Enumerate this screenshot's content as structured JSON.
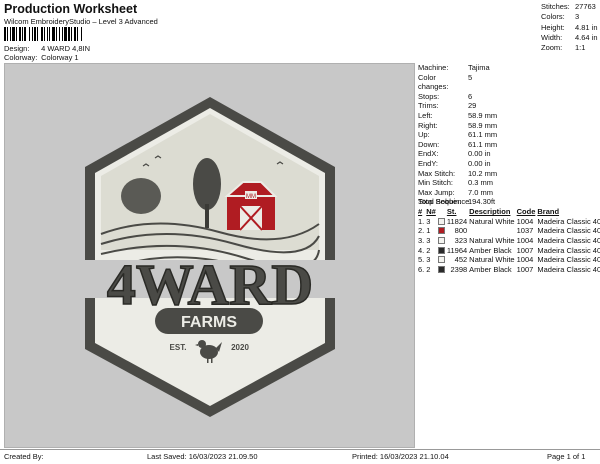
{
  "header": {
    "title": "Production Worksheet",
    "subtitle": "Wilcom EmbroideryStudio – Level 3 Advanced",
    "design_label": "Design:",
    "design_value": "4 WARD 4,8IN",
    "colorway_label": "Colorway:",
    "colorway_value": "Colorway 1"
  },
  "summary": [
    {
      "label": "Stitches:",
      "value": "27763"
    },
    {
      "label": "Colors:",
      "value": "3"
    },
    {
      "label": "Height:",
      "value": "4.81 in"
    },
    {
      "label": "Width:",
      "value": "4.64 in"
    },
    {
      "label": "Zoom:",
      "value": "1:1"
    }
  ],
  "specs": [
    {
      "label": "Machine:",
      "value": "Tajima"
    },
    {
      "label": "Color changes:",
      "value": "5"
    },
    {
      "label": "Stops:",
      "value": "6"
    },
    {
      "label": "Trims:",
      "value": "29"
    },
    {
      "label": "Left:",
      "value": "58.9 mm"
    },
    {
      "label": "Right:",
      "value": "58.9 mm"
    },
    {
      "label": "Up:",
      "value": "61.1 mm"
    },
    {
      "label": "Down:",
      "value": "61.1 mm"
    },
    {
      "label": "EndX:",
      "value": "0.00 in"
    },
    {
      "label": "EndY:",
      "value": "0.00 in"
    },
    {
      "label": "Max Stitch:",
      "value": "10.2 mm"
    },
    {
      "label": "Min Stitch:",
      "value": "0.3 mm"
    },
    {
      "label": "Max Jump:",
      "value": "7.0 mm"
    },
    {
      "label": "Total Bobbin:",
      "value": "194.30ft"
    }
  ],
  "stop_sequence": {
    "title": "Stop Sequence:",
    "columns": [
      "#",
      "N#",
      "",
      "St.",
      "Description",
      "Code",
      "Brand"
    ],
    "rows": [
      {
        "stop": "1.",
        "needle": "3",
        "color": "#f4f4f0",
        "stitches": "11824",
        "description": "Natural White",
        "code": "1004",
        "brand": "Madeira Classic 40"
      },
      {
        "stop": "2.",
        "needle": "1",
        "color": "#b01c22",
        "stitches": "800",
        "description": "",
        "code": "1037",
        "brand": "Madeira Classic 40"
      },
      {
        "stop": "3.",
        "needle": "3",
        "color": "#f4f4f0",
        "stitches": "323",
        "description": "Natural White",
        "code": "1004",
        "brand": "Madeira Classic 40"
      },
      {
        "stop": "4.",
        "needle": "2",
        "color": "#2a2a2a",
        "stitches": "11964",
        "description": "Amber Black",
        "code": "1007",
        "brand": "Madeira Classic 40"
      },
      {
        "stop": "5.",
        "needle": "3",
        "color": "#f4f4f0",
        "stitches": "452",
        "description": "Natural White",
        "code": "1004",
        "brand": "Madeira Classic 40"
      },
      {
        "stop": "6.",
        "needle": "2",
        "color": "#2a2a2a",
        "stitches": "2398",
        "description": "Amber Black",
        "code": "1007",
        "brand": "Madeira Classic 40"
      }
    ]
  },
  "logo": {
    "main_text": "4WARD",
    "banner_text": "FARMS",
    "est_text": "EST.",
    "year_text": "2020",
    "barn_sign": "MM"
  },
  "footer": {
    "created_by": "Created By:",
    "last_saved": "Last Saved: 16/03/2023 21.09.50",
    "printed": "Printed: 16/03/2023 21.10.04",
    "page": "Page 1 of 1"
  },
  "colors": {
    "canvas": "#c8c8c8",
    "thread_white": "#ecece6",
    "thread_red": "#b01c22",
    "thread_black": "#4a4a46"
  }
}
